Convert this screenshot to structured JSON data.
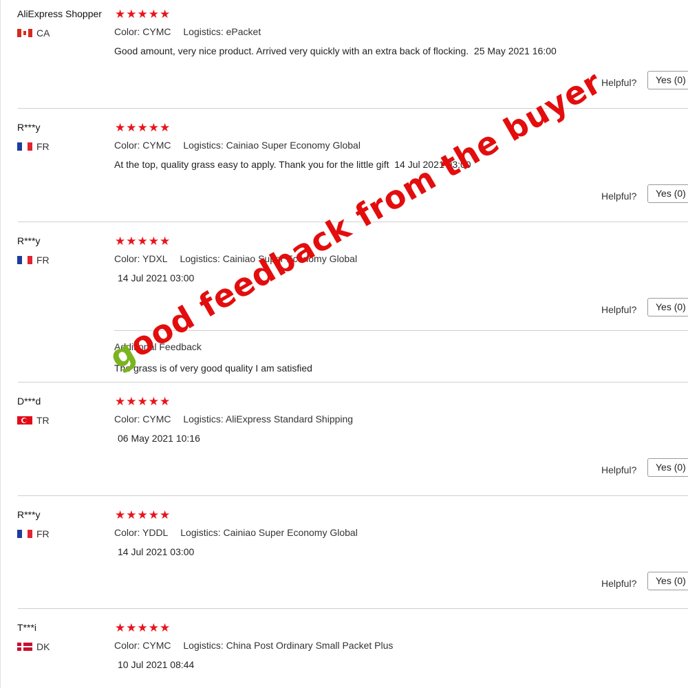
{
  "reviews": [
    {
      "user": "AliExpress Shopper",
      "country": "CA",
      "flag": "canada-flag",
      "stars": "★★★★★",
      "color_label": "Color:",
      "color": "CYMC",
      "logistics_label": "Logistics:",
      "logistics": "ePacket",
      "text": "Good amount, very nice product. Arrived very quickly with an extra back of flocking.",
      "date": "25 May 2021 16:00",
      "helpful": "Helpful?",
      "yes": "Yes (0)"
    },
    {
      "user": "R***y",
      "country": "FR",
      "flag": "france-flag",
      "stars": "★★★★★",
      "color_label": "Color:",
      "color": "CYMC",
      "logistics_label": "Logistics:",
      "logistics": "Cainiao Super Economy Global",
      "text": "At the top, quality grass easy to apply. Thank you for the little gift",
      "date": "14 Jul 2021 03:00",
      "helpful": "Helpful?",
      "yes": "Yes (0)"
    },
    {
      "user": "R***y",
      "country": "FR",
      "flag": "france-flag",
      "stars": "★★★★★",
      "color_label": "Color:",
      "color": "YDXL",
      "logistics_label": "Logistics:",
      "logistics": "Cainiao Super Economy Global",
      "date": "14 Jul 2021 03:00",
      "helpful": "Helpful?",
      "yes": "Yes (0)",
      "additional_title": "Additional Feedback",
      "additional_text": "The grass is of very good quality I am satisfied"
    },
    {
      "user": "D***d",
      "country": "TR",
      "flag": "turkey-flag",
      "stars": "★★★★★",
      "color_label": "Color:",
      "color": "CYMC",
      "logistics_label": "Logistics:",
      "logistics": "AliExpress Standard Shipping",
      "date": "06 May 2021 10:16",
      "helpful": "Helpful?",
      "yes": "Yes (0)"
    },
    {
      "user": "R***y",
      "country": "FR",
      "flag": "france-flag",
      "stars": "★★★★★",
      "color_label": "Color:",
      "color": "YDDL",
      "logistics_label": "Logistics:",
      "logistics": "Cainiao Super Economy Global",
      "date": "14 Jul 2021 03:00",
      "helpful": "Helpful?",
      "yes": "Yes (0)"
    },
    {
      "user": "T***i",
      "country": "DK",
      "flag": "denmark-flag",
      "stars": "★★★★★",
      "color_label": "Color:",
      "color": "CYMC",
      "logistics_label": "Logistics:",
      "logistics": "China Post Ordinary Small Packet Plus",
      "date": "10 Jul 2021 08:44"
    }
  ],
  "overlay": {
    "first_letter": "g",
    "rest": "ood feedback from the buyer"
  },
  "colors": {
    "star": "#e8141b",
    "overlay": "#e30d0d",
    "overlay_first": "#7ab51d"
  }
}
